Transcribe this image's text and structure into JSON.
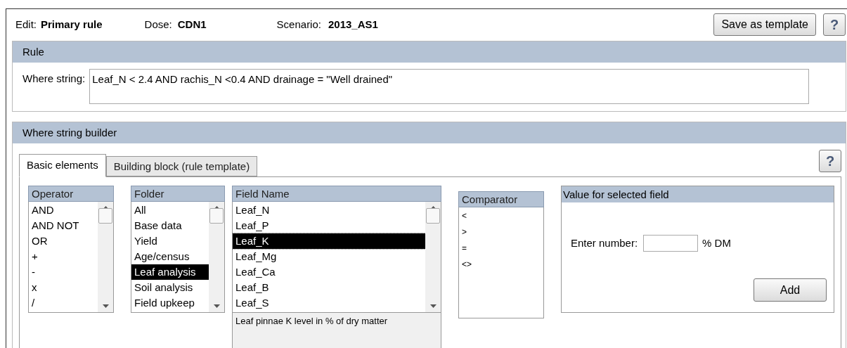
{
  "header": {
    "edit_label": "Edit:",
    "edit_value": "Primary rule",
    "dose_label": "Dose:",
    "dose_value": "CDN1",
    "scenario_label": "Scenario:",
    "scenario_value": "2013_AS1",
    "save_button": "Save as template",
    "help_button": "?"
  },
  "rule": {
    "title": "Rule",
    "where_label": "Where string:",
    "where_value": "Leaf_N < 2.4 AND rachis_N <0.4 AND drainage = \"Well drained\""
  },
  "builder": {
    "title": "Where string builder",
    "help_button": "?",
    "tabs": [
      {
        "label": "Basic elements",
        "selected": true
      },
      {
        "label": "Building block (rule template)",
        "selected": false
      }
    ],
    "operator": {
      "title": "Operator",
      "items": [
        {
          "label": "AND",
          "selected": false
        },
        {
          "label": "AND NOT",
          "selected": false
        },
        {
          "label": "OR",
          "selected": false
        },
        {
          "label": "+",
          "selected": false
        },
        {
          "label": "-",
          "selected": false
        },
        {
          "label": "x",
          "selected": false
        },
        {
          "label": "/",
          "selected": false
        }
      ]
    },
    "folder": {
      "title": "Folder",
      "items": [
        {
          "label": "All",
          "selected": false
        },
        {
          "label": "Base data",
          "selected": false
        },
        {
          "label": "Yield",
          "selected": false
        },
        {
          "label": "Age/census",
          "selected": false
        },
        {
          "label": "Leaf analysis",
          "selected": true
        },
        {
          "label": "Soil analysis",
          "selected": false
        },
        {
          "label": "Field upkeep",
          "selected": false
        }
      ]
    },
    "field_name": {
      "title": "Field Name",
      "items": [
        {
          "label": "Leaf_N",
          "selected": false
        },
        {
          "label": "Leaf_P",
          "selected": false
        },
        {
          "label": "Leaf_K",
          "selected": true
        },
        {
          "label": "Leaf_Mg",
          "selected": false
        },
        {
          "label": "Leaf_Ca",
          "selected": false
        },
        {
          "label": "Leaf_B",
          "selected": false
        },
        {
          "label": "Leaf_S",
          "selected": false
        }
      ],
      "description": "Leaf pinnae K level in % of dry matter"
    },
    "comparator": {
      "title": "Comparator",
      "items": [
        {
          "label": "<",
          "selected": false
        },
        {
          "label": ">",
          "selected": false
        },
        {
          "label": "=",
          "selected": false
        },
        {
          "label": "<>",
          "selected": false
        }
      ]
    },
    "value": {
      "title": "Value for selected field",
      "label": "Enter number:",
      "unit": "% DM",
      "add_button": "Add"
    }
  }
}
